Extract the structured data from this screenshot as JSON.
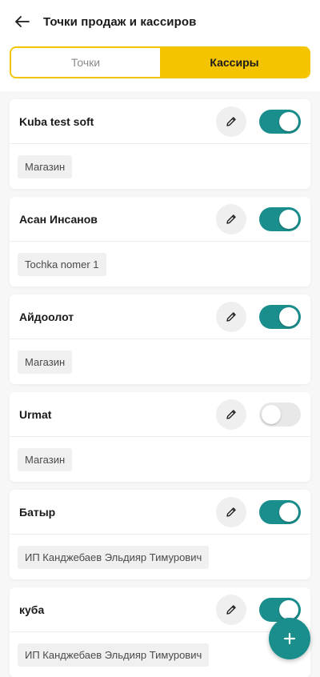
{
  "header": {
    "title": "Точки продаж и кассиров",
    "back_icon": "arrow-left-icon"
  },
  "tabs": [
    {
      "label": "Точки",
      "active": false
    },
    {
      "label": "Кассиры",
      "active": true
    }
  ],
  "cashiers": [
    {
      "name": "Kuba test soft",
      "point": "Магазин",
      "enabled": true
    },
    {
      "name": "Асан Инсанов",
      "point": "Tochka nomer 1",
      "enabled": true
    },
    {
      "name": "Айдоолот",
      "point": "Магазин",
      "enabled": true
    },
    {
      "name": "Urmat",
      "point": "Магазин",
      "enabled": false
    },
    {
      "name": "Батыр",
      "point": "ИП Канджебаев Эльдияр Тимурович",
      "enabled": true
    },
    {
      "name": "куба",
      "point": "ИП Канджебаев Эльдияр Тимурович",
      "enabled": true
    }
  ],
  "fab": {
    "label": "+",
    "icon": "plus-icon"
  },
  "colors": {
    "accent": "#f5c400",
    "teal": "#1a8e8c",
    "toggle_off": "#e8e8e8"
  }
}
